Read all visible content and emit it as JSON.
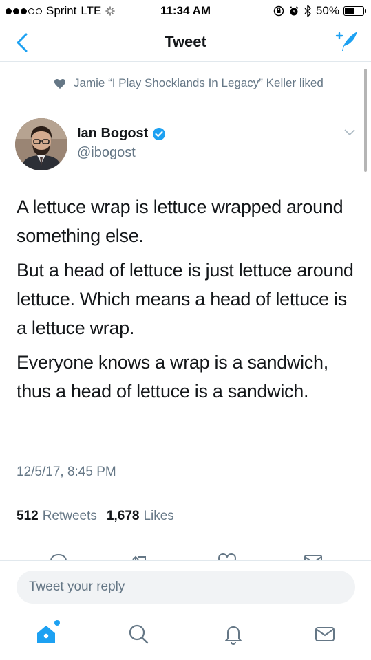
{
  "status_bar": {
    "carrier": "Sprint",
    "network": "LTE",
    "time": "11:34 AM",
    "battery": "50%",
    "battery_level": 0.5
  },
  "nav": {
    "title": "Tweet",
    "back_icon": "chevron-left-icon",
    "compose_icon": "compose-tweet-icon"
  },
  "context": {
    "icon": "heart-icon",
    "text": "Jamie “I Play Shocklands In Legacy” Keller liked"
  },
  "author": {
    "name": "Ian Bogost",
    "handle": "@ibogost",
    "verified": true
  },
  "tweet": {
    "paragraphs": [
      "A lettuce wrap is lettuce wrapped around something else.",
      "But a head of lettuce is just lettuce around lettuce. Which means a head of lettuce is a lettuce wrap.",
      "Everyone knows a wrap is a sandwich, thus a head of lettuce is a sandwich."
    ],
    "timestamp": "12/5/17, 8:45 PM"
  },
  "stats": {
    "retweets_count": "512",
    "retweets_label": "Retweets",
    "likes_count": "1,678",
    "likes_label": "Likes"
  },
  "reply": {
    "placeholder": "Tweet your reply"
  },
  "colors": {
    "accent": "#1da1f2",
    "secondary_text": "#657786",
    "divider": "#e1e8ed"
  },
  "tabs": [
    "home-icon",
    "search-icon",
    "notifications-icon",
    "messages-icon"
  ]
}
